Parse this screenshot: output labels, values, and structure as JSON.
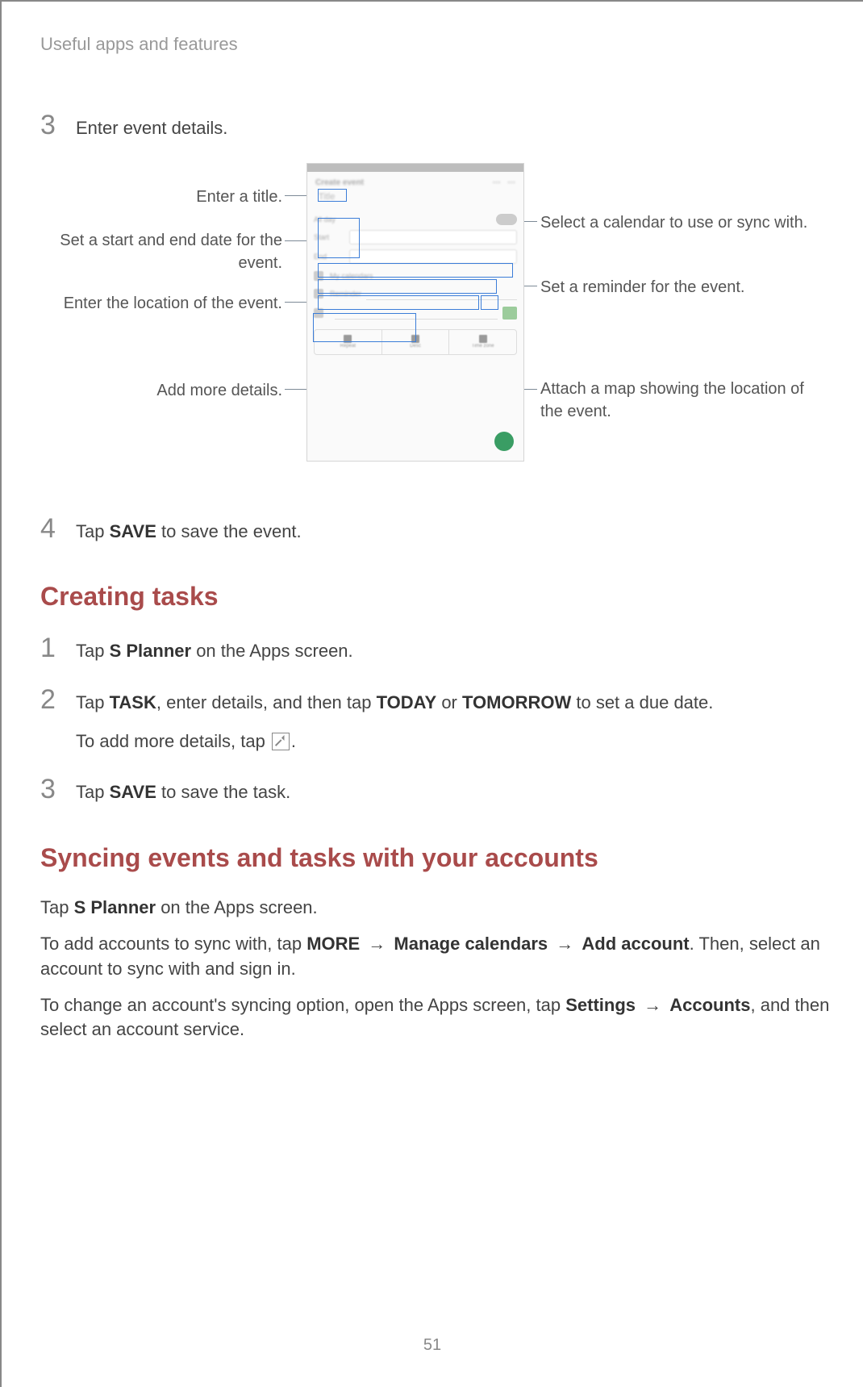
{
  "header": {
    "title": "Useful apps and features"
  },
  "page_number": "51",
  "section_a": {
    "step3": {
      "num": "3",
      "text": "Enter event details."
    },
    "step4": {
      "num": "4",
      "prefix": "Tap ",
      "bold": "SAVE",
      "suffix": " to save the event."
    }
  },
  "figure": {
    "left": {
      "title": "Enter a title.",
      "dates": "Set a start and end date for the event.",
      "location": "Enter the location of the event.",
      "more": "Add more details."
    },
    "right": {
      "calendar": "Select a calendar to use or sync with.",
      "reminder": "Set a reminder for the event.",
      "map": "Attach a map showing the location of the event."
    },
    "phone": {
      "header": "Create event",
      "title_placeholder": "Title",
      "allday": "All day",
      "start": "Start",
      "end": "End",
      "calendar": "My calendars",
      "reminder": "Reminder",
      "location": "Location",
      "toolbar": [
        "Repeat",
        "Desc",
        "Time zone"
      ]
    }
  },
  "creating_tasks": {
    "heading": "Creating tasks",
    "step1": {
      "num": "1",
      "prefix": "Tap ",
      "bold": "S Planner",
      "suffix": " on the Apps screen."
    },
    "step2": {
      "num": "2",
      "line1_prefix": "Tap ",
      "line1_b1": "TASK",
      "line1_mid": ", enter details, and then tap ",
      "line1_b2": "TODAY",
      "line1_or": " or ",
      "line1_b3": "TOMORROW",
      "line1_suffix": " to set a due date.",
      "line2_prefix": "To add more details, tap ",
      "line2_suffix": "."
    },
    "step3": {
      "num": "3",
      "prefix": "Tap ",
      "bold": "SAVE",
      "suffix": " to save the task."
    }
  },
  "syncing": {
    "heading": "Syncing events and tasks with your accounts",
    "p1_prefix": "Tap ",
    "p1_bold": "S Planner",
    "p1_suffix": " on the Apps screen.",
    "p2_a": "To add accounts to sync with, tap ",
    "p2_b1": "MORE",
    "p2_arr1": " → ",
    "p2_b2": "Manage calendars",
    "p2_arr2": " → ",
    "p2_b3": "Add account",
    "p2_rest": ". Then, select an account to sync with and sign in.",
    "p3_a": "To change an account's syncing option, open the Apps screen, tap ",
    "p3_b1": "Settings",
    "p3_arr": " → ",
    "p3_b2": "Accounts",
    "p3_rest": ", and then select an account service."
  }
}
